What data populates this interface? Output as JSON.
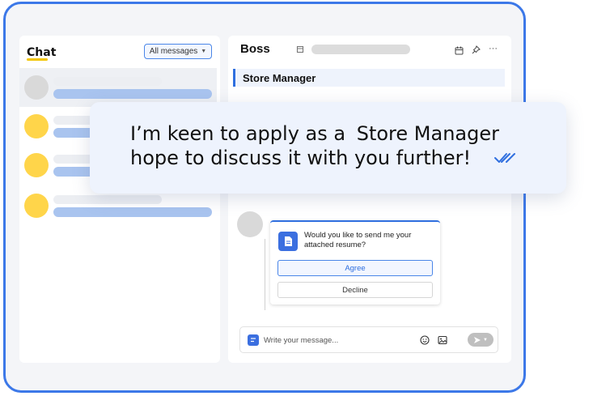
{
  "sidebar": {
    "title": "Chat",
    "filter_label": "All messages",
    "conversations": [
      {
        "avatar_color": "#d9d9d9"
      },
      {
        "avatar_color": "#ffd54a"
      },
      {
        "avatar_color": "#ffd54a"
      },
      {
        "avatar_color": "#ffd54a"
      }
    ]
  },
  "header": {
    "name": "Boss",
    "icons": [
      "building-icon",
      "calendar-icon",
      "pin-icon",
      "more-icon"
    ]
  },
  "job": {
    "title": "Store Manager"
  },
  "bubble": {
    "line1_prefix": "I’m keen to apply as a",
    "line1_role": "Store Manager",
    "line2": "hope to discuss it with you further!"
  },
  "card": {
    "prompt": "Would you like to send me your attached resume?",
    "agree_label": "Agree",
    "decline_label": "Decline"
  },
  "composer": {
    "placeholder": "Write your message..."
  },
  "colors": {
    "accent": "#2f6fdf",
    "frame": "#3c78e8",
    "highlight": "#f2c500"
  }
}
